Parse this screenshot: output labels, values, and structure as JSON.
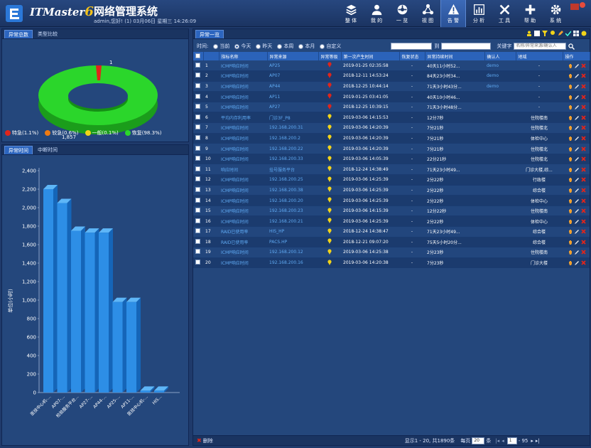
{
  "header": {
    "brand_text": "ITMaster",
    "brand_num": "6",
    "title": "网络管理系统",
    "user_info": "admin,您好! (1) 03月06日 星期三 14:26:09"
  },
  "nav": [
    {
      "label": "整 体",
      "icon": "layers-icon"
    },
    {
      "label": "我 的",
      "icon": "user-icon"
    },
    {
      "label": "一 览",
      "icon": "dashboard-icon"
    },
    {
      "label": "视 图",
      "icon": "topology-icon"
    },
    {
      "label": "告 警",
      "icon": "alert-icon"
    },
    {
      "label": "分 析",
      "icon": "chart-icon"
    },
    {
      "label": "工 具",
      "icon": "tools-icon"
    },
    {
      "label": "帮 助",
      "icon": "plus-icon"
    },
    {
      "label": "系 统",
      "icon": "gear-icon"
    }
  ],
  "colors": {
    "accent": "#2c65bf",
    "link": "#5fa9f2",
    "green": "#2bd62b",
    "red": "#e0251b",
    "orange": "#ee7a12",
    "yellow": "#f2d319"
  },
  "left_top": {
    "tabs": [
      "异常总数",
      "类型比较"
    ],
    "pie": {
      "label_top": "1",
      "label_bottom": "1,857"
    },
    "legend": [
      {
        "label": "特急(1.1%)",
        "color": "#e0251b"
      },
      {
        "label": "较急(0.6%)",
        "color": "#ee7a12"
      },
      {
        "label": "一般(0.1%)",
        "color": "#f2d319"
      },
      {
        "label": "恢复(98.3%)",
        "color": "#2bd62b"
      }
    ]
  },
  "left_bottom": {
    "tabs": [
      "异常时间",
      "中断时间"
    ]
  },
  "chart_data": {
    "type": "bar",
    "title": "",
    "ylabel": "单位(小时)",
    "xlabel": "",
    "ylim": [
      0,
      2400
    ],
    "yticks": [
      "0",
      "200",
      "400",
      "600",
      "800",
      "1,000",
      "1,200",
      "1,400",
      "1,600",
      "1,800",
      "2,000",
      "2,200",
      "2,400"
    ],
    "categories": [
      "医技中心机-...",
      "AP07-...",
      "检验服务平台...",
      "AP27-...",
      "AP44-...",
      "AP25-...",
      "AP11-...",
      "医技中心机-...",
      "HIS..."
    ],
    "values": [
      2200,
      2050,
      1750,
      1730,
      1730,
      980,
      980,
      20,
      20
    ]
  },
  "list": {
    "tab": "异常一览",
    "filter": {
      "label": "时间:",
      "options": [
        "当前",
        "今天",
        "昨天",
        "本周",
        "本月",
        "自定义"
      ],
      "selected": "今天",
      "date_to": "到",
      "keyword_label": "关键字",
      "keyword_placeholder": "名称/异常来源/确认人"
    },
    "columns": [
      "",
      "",
      "指标名称",
      "异常来源",
      "异常等级",
      "第一次产生时间",
      "恢复状态",
      "异常持续时间",
      "确认人",
      "地域",
      "操作"
    ],
    "rows": [
      {
        "n": "1",
        "name": "ICMP响应时间",
        "src": "AP25",
        "lvl": "red",
        "time": "2019-01-25 02:35:58",
        "st": "-",
        "dur": "40天11小时52...",
        "who": "demo",
        "area": "-"
      },
      {
        "n": "2",
        "name": "ICMP响应时间",
        "src": "AP07",
        "lvl": "red",
        "time": "2018-12-11 14:53:24",
        "st": "-",
        "dur": "84天23小时34...",
        "who": "demo",
        "area": "-"
      },
      {
        "n": "3",
        "name": "ICMP响应时间",
        "src": "AP44",
        "lvl": "red",
        "time": "2018-12-25 10:44:14",
        "st": "-",
        "dur": "71天3小时43分...",
        "who": "demo",
        "area": "-"
      },
      {
        "n": "4",
        "name": "ICMP响应时间",
        "src": "AP11",
        "lvl": "red",
        "time": "2019-01-25 03:41:05",
        "st": "-",
        "dur": "40天10小时46...",
        "who": "",
        "area": "-"
      },
      {
        "n": "5",
        "name": "ICMP响应时间",
        "src": "AP27",
        "lvl": "red",
        "time": "2018-12-25 10:39:15",
        "st": "-",
        "dur": "71天3小时48分...",
        "who": "",
        "area": "-"
      },
      {
        "n": "6",
        "name": "平均内存利用率",
        "src": "门诊3F_P8",
        "lvl": "yellow",
        "time": "2019-03-06 14:15:53",
        "st": "-",
        "dur": "12分7秒",
        "who": "",
        "area": "住院楼南"
      },
      {
        "n": "7",
        "name": "ICMP响应时间",
        "src": "192.168.200.31",
        "lvl": "yellow",
        "time": "2019-03-06 14:20:39",
        "st": "-",
        "dur": "7分21秒",
        "who": "",
        "area": "住院楼北"
      },
      {
        "n": "8",
        "name": "ICMP响应时间",
        "src": "192.168.200.2",
        "lvl": "yellow",
        "time": "2019-03-06 14:20:39",
        "st": "-",
        "dur": "7分21秒",
        "who": "",
        "area": "体检中心"
      },
      {
        "n": "9",
        "name": "ICMP响应时间",
        "src": "192.168.200.22",
        "lvl": "yellow",
        "time": "2019-03-06 14:20:39",
        "st": "-",
        "dur": "7分21秒",
        "who": "",
        "area": "住院楼北"
      },
      {
        "n": "10",
        "name": "ICMP响应时间",
        "src": "192.168.200.33",
        "lvl": "yellow",
        "time": "2019-03-06 14:05:39",
        "st": "-",
        "dur": "22分21秒",
        "who": "",
        "area": "住院楼北"
      },
      {
        "n": "11",
        "name": "响应时间",
        "src": "挂号服务平台",
        "lvl": "yellow",
        "time": "2018-12-24 14:38:49",
        "st": "-",
        "dur": "71天23小时49...",
        "who": "",
        "area": "门诊大楼,综..."
      },
      {
        "n": "12",
        "name": "ICMP响应时间",
        "src": "192.168.200.25",
        "lvl": "yellow",
        "time": "2019-03-06 14:25:39",
        "st": "-",
        "dur": "2分22秒",
        "who": "",
        "area": "行政楼"
      },
      {
        "n": "13",
        "name": "ICMP响应时间",
        "src": "192.168.200.38",
        "lvl": "yellow",
        "time": "2019-03-06 14:25:39",
        "st": "-",
        "dur": "2分22秒",
        "who": "",
        "area": "综合楼"
      },
      {
        "n": "14",
        "name": "ICMP响应时间",
        "src": "192.168.200.20",
        "lvl": "yellow",
        "time": "2019-03-06 14:25:39",
        "st": "-",
        "dur": "2分22秒",
        "who": "",
        "area": "体检中心"
      },
      {
        "n": "15",
        "name": "ICMP响应时间",
        "src": "192.168.200.23",
        "lvl": "yellow",
        "time": "2019-03-06 14:15:39",
        "st": "-",
        "dur": "12分22秒",
        "who": "",
        "area": "住院楼南"
      },
      {
        "n": "16",
        "name": "ICMP响应时间",
        "src": "192.168.200.21",
        "lvl": "yellow",
        "time": "2019-03-06 14:25:39",
        "st": "-",
        "dur": "2分22秒",
        "who": "",
        "area": "体检中心"
      },
      {
        "n": "17",
        "name": "RAID已使用率",
        "src": "HIS_HP",
        "lvl": "yellow",
        "time": "2018-12-24 14:38:47",
        "st": "-",
        "dur": "71天23小时49...",
        "who": "",
        "area": "综合楼"
      },
      {
        "n": "18",
        "name": "RAID已使用率",
        "src": "PACS.HP",
        "lvl": "yellow",
        "time": "2018-12-21 09:07:20",
        "st": "-",
        "dur": "75天5小时20分...",
        "who": "",
        "area": "综合楼"
      },
      {
        "n": "19",
        "name": "ICMP响应时间",
        "src": "192.168.200.12",
        "lvl": "yellow",
        "time": "2019-03-06 14:25:38",
        "st": "-",
        "dur": "2分23秒",
        "who": "",
        "area": "住院楼南"
      },
      {
        "n": "20",
        "name": "ICMP响应时间",
        "src": "192.168.200.16",
        "lvl": "yellow",
        "time": "2019-03-06 14:20:38",
        "st": "-",
        "dur": "7分23秒",
        "who": "",
        "area": "门诊大楼"
      }
    ],
    "footer": {
      "delete": "删除",
      "summary": "显示1 - 20, 共1890条",
      "per_page_label": "每页",
      "per_page": "20",
      "unit": "条",
      "page": "1",
      "total_pages": "- 95"
    }
  }
}
